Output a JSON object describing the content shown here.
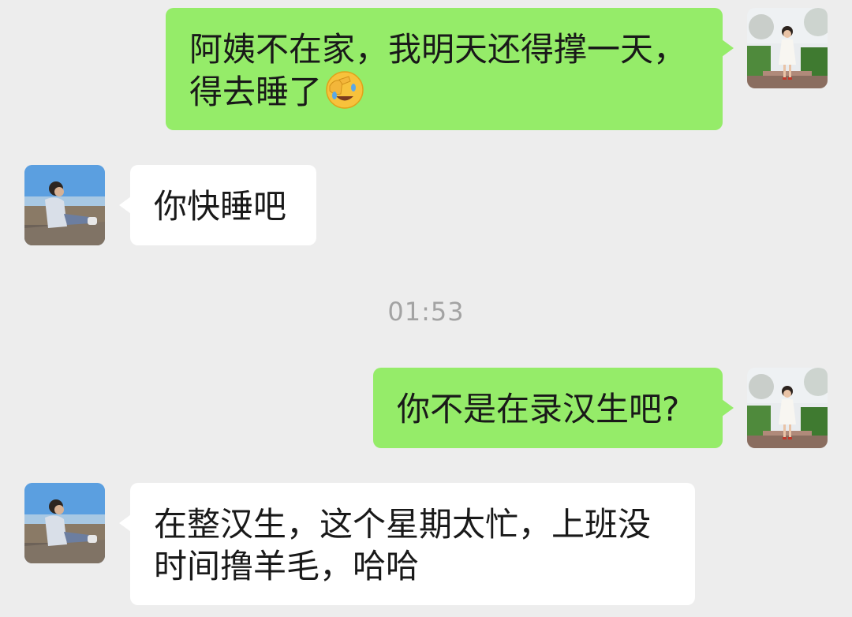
{
  "messages": [
    {
      "sender": "self",
      "avatar_icon": "girl-in-garden-avatar",
      "lines": [
        "阿姨不在家，我明天还得撑一天，",
        "得去睡了"
      ],
      "emoji_icon": "face-palm-emoji"
    },
    {
      "sender": "other",
      "avatar_icon": "girl-by-sea-avatar",
      "lines": [
        "你快睡吧"
      ]
    },
    {
      "sender": "self",
      "avatar_icon": "girl-in-garden-avatar",
      "lines": [
        "你不是在录汉生吧?"
      ]
    },
    {
      "sender": "other",
      "avatar_icon": "girl-by-sea-avatar",
      "lines": [
        "在整汉生，这个星期太忙，上班没",
        "时间撸羊毛，哈哈"
      ]
    }
  ],
  "timestamp": "01:53",
  "colors": {
    "background": "#ededed",
    "self_bubble": "#95ec69",
    "other_bubble": "#ffffff",
    "timestamp_text": "#a3a3a3"
  }
}
